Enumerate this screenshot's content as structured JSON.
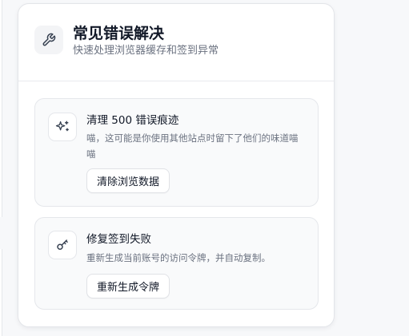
{
  "header": {
    "icon": "wrench-icon",
    "title": "常见错误解决",
    "subtitle": "快速处理浏览器缓存和签到异常"
  },
  "actions": [
    {
      "icon": "sparkles-icon",
      "title": "清理 500 错误痕迹",
      "description": "喵，这可能是你使用其他站点时留下了他们的味道喵喵",
      "button_label": "清除浏览数据"
    },
    {
      "icon": "key-icon",
      "title": "修复签到失败",
      "description": "重新生成当前账号的访问令牌，并自动复制。",
      "button_label": "重新生成令牌"
    }
  ]
}
